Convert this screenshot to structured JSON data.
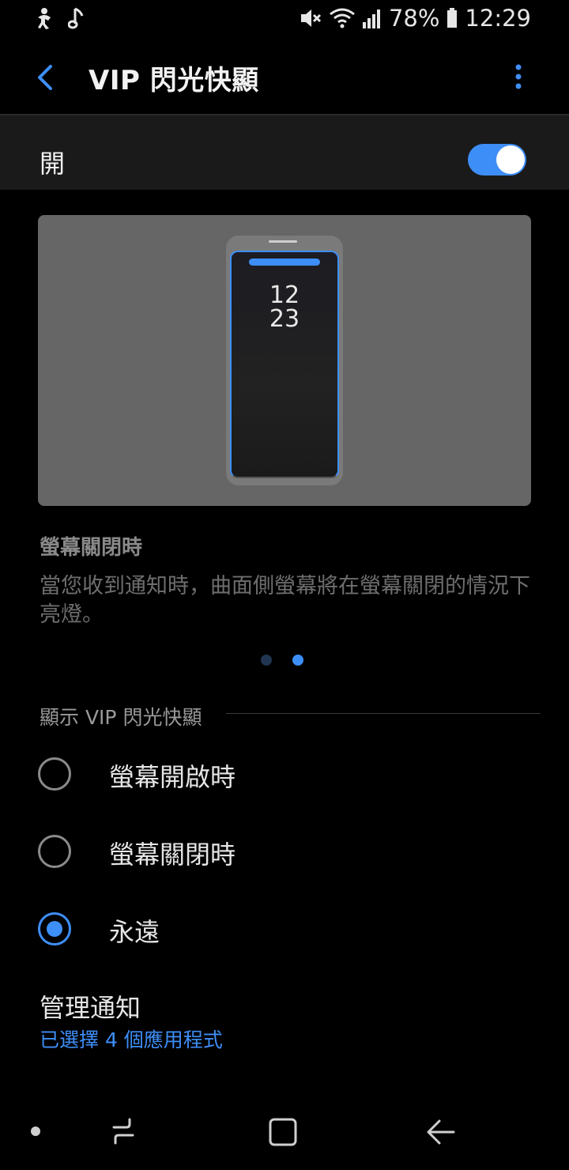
{
  "status_bar": {
    "left_icons": [
      "notification-icon",
      "music-note-icon"
    ],
    "right_icons": [
      "mute-icon",
      "wifi-icon",
      "signal-icon",
      "battery-icon"
    ],
    "battery": "78%",
    "time": "12:29"
  },
  "header": {
    "title": "VIP 閃光快顯",
    "back_icon": "back-arrow-icon",
    "more_icon": "more-vert-icon"
  },
  "master_switch": {
    "label": "開",
    "on": true
  },
  "preview": {
    "clock_hour": "12",
    "clock_minute": "23"
  },
  "description": {
    "title": "螢幕關閉時",
    "body": "當您收到通知時，曲面側螢幕將在螢幕關閉的情況下亮燈。"
  },
  "pager": {
    "count": 2,
    "active_index": 1
  },
  "display_section": {
    "header": "顯示 VIP 閃光快顯",
    "options": [
      {
        "label": "螢幕開啟時",
        "checked": false
      },
      {
        "label": "螢幕關閉時",
        "checked": false
      },
      {
        "label": "永遠",
        "checked": true
      }
    ]
  },
  "manage": {
    "title": "管理通知",
    "subtitle": "已選擇 4 個應用程式"
  },
  "colors": {
    "accent": "#3e8ef7",
    "background": "#000000",
    "row_background": "#1a1a1a"
  }
}
